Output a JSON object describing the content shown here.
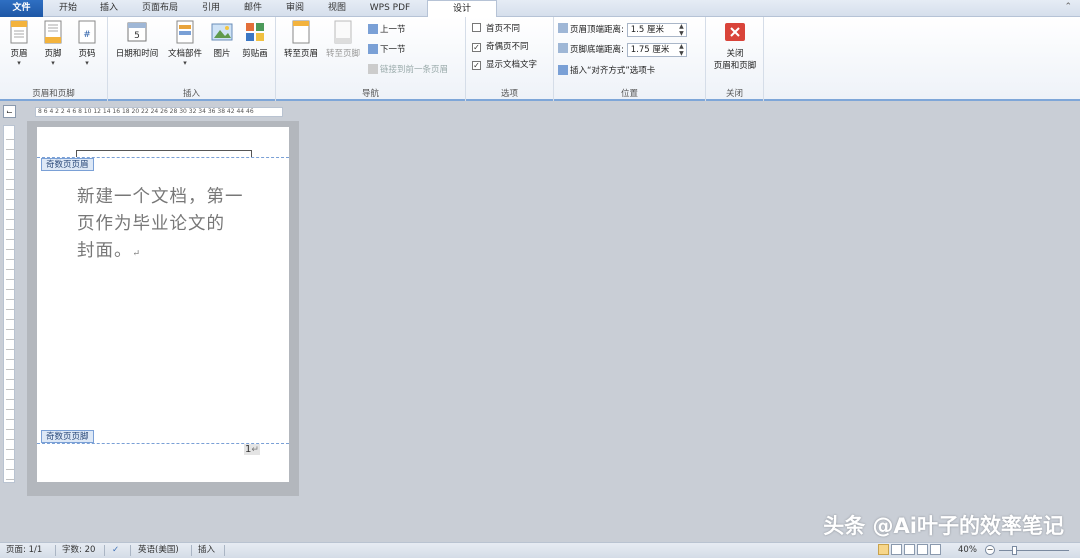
{
  "tabs": [
    "文件",
    "开始",
    "插入",
    "页面布局",
    "引用",
    "邮件",
    "审阅",
    "视图",
    "WPS PDF",
    "设计"
  ],
  "ribbon": {
    "group_header_footer": {
      "label": "页眉和页脚",
      "buttons": [
        "页眉",
        "页脚",
        "页码"
      ]
    },
    "group_insert": {
      "label": "插入",
      "buttons": [
        "日期和时间",
        "文档部件",
        "图片",
        "剪贴画"
      ]
    },
    "group_nav": {
      "label": "导航",
      "goto_header": "转至页眉",
      "goto_footer": "转至页脚",
      "prev_section": "上一节",
      "next_section": "下一节",
      "link_previous": "链接到前一条页眉"
    },
    "group_options": {
      "label": "选项",
      "diff_first_page": "首页不同",
      "diff_odd_even": "奇偶页不同",
      "show_doc_text": "显示文档文字",
      "checked": {
        "diff_first_page": false,
        "diff_odd_even": true,
        "show_doc_text": true
      }
    },
    "group_position": {
      "label": "位置",
      "header_top_label": "页眉顶端距离:",
      "header_top_value": "1.5 厘米",
      "footer_bottom_label": "页脚底端距离:",
      "footer_bottom_value": "1.75 厘米",
      "insert_align_tab": "插入“对齐方式”选项卡"
    },
    "group_close": {
      "label": "关闭",
      "close_line1": "关闭",
      "close_line2": "页眉和页脚"
    }
  },
  "ruler_text": "8 6 4 2   2 4 6 8 10 12 14 16 18 20 22 24 26 28 30 32 34 36 38   42 44 46",
  "document": {
    "header_tag": "奇数页页眉",
    "footer_tag": "奇数页页脚",
    "body_line1": "新建一个文档，第一",
    "body_line2": "页作为毕业论文的",
    "body_line3": "封面。",
    "page_number": "1"
  },
  "watermark": "头条 @Ai叶子的效率笔记",
  "statusbar": {
    "page": "页面: 1/1",
    "words": "字数: 20",
    "language": "英语(美国)",
    "mode": "插入",
    "zoom": "40%",
    "zoom_fraction": 0.4
  }
}
